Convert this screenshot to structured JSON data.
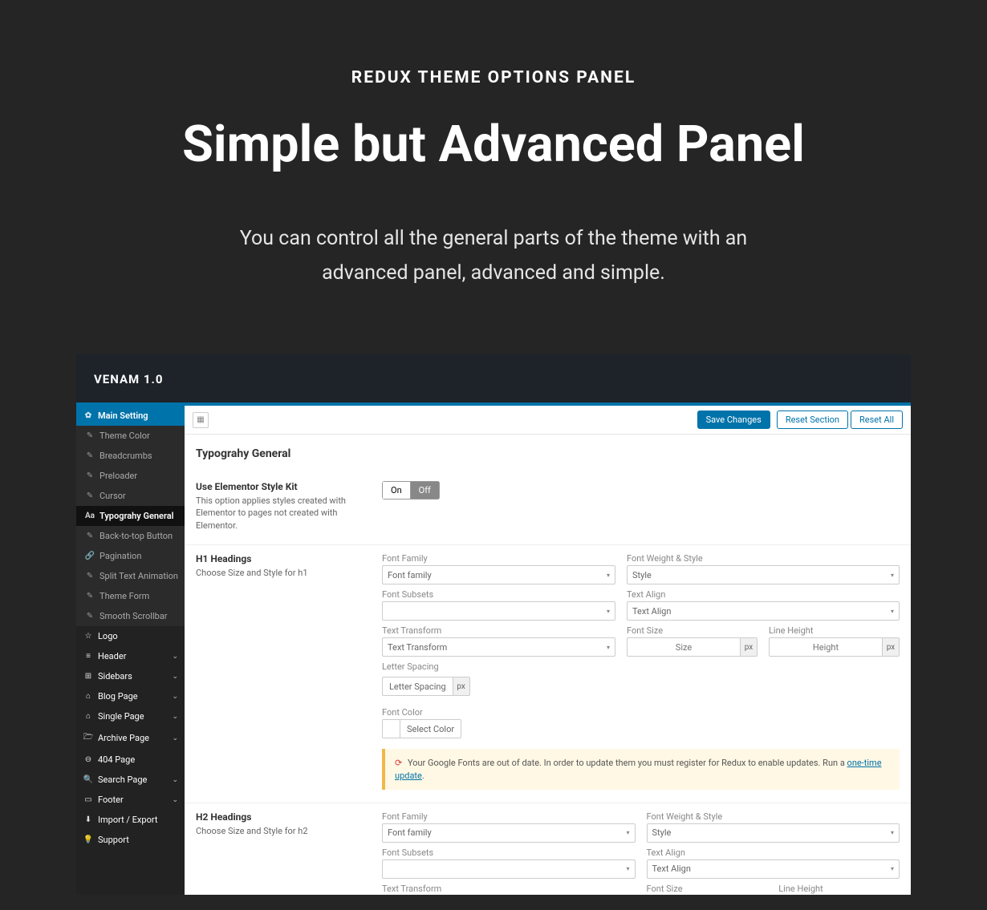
{
  "hero": {
    "eyebrow": "REDUX THEME OPTIONS PANEL",
    "title": "Simple but Advanced Panel",
    "desc": "You can control all the general parts of the theme with an advanced panel, advanced and simple."
  },
  "panel": {
    "title": "VENAM 1.0"
  },
  "topbar": {
    "save": "Save Changes",
    "reset_section": "Reset Section",
    "reset_all": "Reset All"
  },
  "sidebar": {
    "main": "Main Setting",
    "items": [
      {
        "icon": "✎",
        "label": "Theme Color"
      },
      {
        "icon": "✎",
        "label": "Breadcrumbs"
      },
      {
        "icon": "✎",
        "label": "Preloader"
      },
      {
        "icon": "✎",
        "label": "Cursor"
      },
      {
        "icon": "Aa",
        "label": "Typograhy General",
        "selected": true
      },
      {
        "icon": "✎",
        "label": "Back-to-top Button"
      },
      {
        "icon": "🔗",
        "label": "Pagination"
      },
      {
        "icon": "✎",
        "label": "Split Text Animation"
      },
      {
        "icon": "✎",
        "label": "Theme Form"
      },
      {
        "icon": "✎",
        "label": "Smooth Scrollbar"
      }
    ],
    "sections": [
      {
        "icon": "☆",
        "label": "Logo"
      },
      {
        "icon": "≡",
        "label": "Header",
        "chev": true
      },
      {
        "icon": "⊞",
        "label": "Sidebars",
        "chev": true
      },
      {
        "icon": "⌂",
        "label": "Blog Page",
        "chev": true
      },
      {
        "icon": "⌂",
        "label": "Single Page",
        "chev": true
      },
      {
        "icon": "🗁",
        "label": "Archive Page",
        "chev": true
      },
      {
        "icon": "⊖",
        "label": "404 Page"
      },
      {
        "icon": "🔍",
        "label": "Search Page",
        "chev": true
      },
      {
        "icon": "▭",
        "label": "Footer",
        "chev": true
      },
      {
        "icon": "⬇",
        "label": "Import / Export"
      },
      {
        "icon": "💡",
        "label": "Support"
      }
    ]
  },
  "content": {
    "section_title": "Typograhy General",
    "elementor": {
      "label": "Use Elementor Style Kit",
      "desc": "This option applies styles created with Elementor to pages not created with Elementor.",
      "on": "On",
      "off": "Off"
    },
    "h1": {
      "label": "H1 Headings",
      "desc": "Choose Size and Style for h1"
    },
    "h2": {
      "label": "H2 Headings",
      "desc": "Choose Size and Style for h2"
    },
    "typo": {
      "font_family_label": "Font Family",
      "font_family_ph": "Font family",
      "font_weight_label": "Font Weight & Style",
      "font_weight_ph": "Style",
      "font_subsets_label": "Font Subsets",
      "text_align_label": "Text Align",
      "text_align_ph": "Text Align",
      "text_transform_label": "Text Transform",
      "text_transform_ph": "Text Transform",
      "font_size_label": "Font Size",
      "font_size_ph": "Size",
      "line_height_label": "Line Height",
      "line_height_ph": "Height",
      "letter_spacing_label": "Letter Spacing",
      "letter_spacing_ph": "Letter Spacing",
      "font_color_label": "Font Color",
      "select_color": "Select Color",
      "px": "px"
    },
    "notice": {
      "text_before": "Your Google Fonts are out of date. In order to update them you must register for Redux to enable updates. Run a ",
      "link": "one-time update",
      "text_after": "."
    }
  }
}
